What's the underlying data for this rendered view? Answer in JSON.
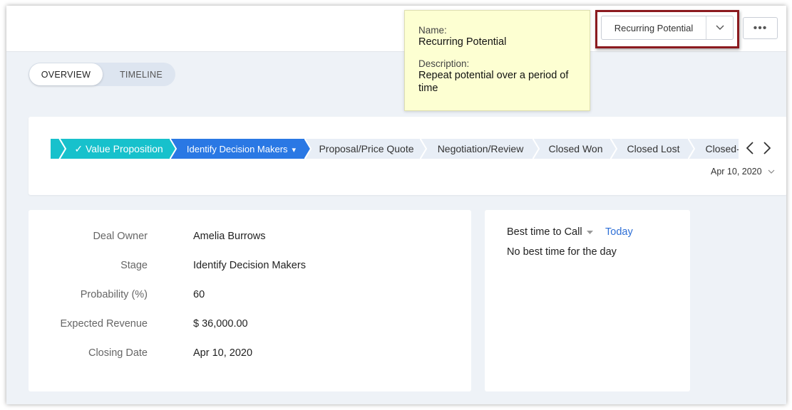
{
  "header": {
    "picker_label": "Recurring Potential",
    "more_label": "•••"
  },
  "tooltip": {
    "name_key": "Name:",
    "name_value": "Recurring Potential",
    "desc_key": "Description:",
    "desc_value": "Repeat potential over a period of time"
  },
  "tabs": [
    {
      "label": "OVERVIEW",
      "active": true
    },
    {
      "label": "TIMELINE",
      "active": false
    }
  ],
  "stages": [
    {
      "label": "",
      "state": "done"
    },
    {
      "label": "Value Proposition",
      "state": "done",
      "check": "✓"
    },
    {
      "label": "Identify Decision Makers",
      "state": "current",
      "caret": "▾"
    },
    {
      "label": "Proposal/Price Quote",
      "state": "pending"
    },
    {
      "label": "Negotiation/Review",
      "state": "pending"
    },
    {
      "label": "Closed Won",
      "state": "pending"
    },
    {
      "label": "Closed Lost",
      "state": "pending"
    },
    {
      "label": "Closed-L",
      "state": "pending"
    }
  ],
  "stage_date": "Apr 10, 2020",
  "colors": {
    "done": "#17c1cc",
    "current": "#2a78e4",
    "pending": "#e8eef6",
    "highlight": "#8b1a1f",
    "link": "#2e6fd6"
  },
  "details": {
    "fields": [
      {
        "label": "Deal Owner",
        "value": "Amelia Burrows"
      },
      {
        "label": "Stage",
        "value": "Identify Decision Makers"
      },
      {
        "label": "Probability (%)",
        "value": "60"
      },
      {
        "label": "Expected Revenue",
        "value": "$ 36,000.00"
      },
      {
        "label": "Closing Date",
        "value": "Apr 10, 2020"
      }
    ]
  },
  "best_time": {
    "label": "Best time to Call",
    "today": "Today",
    "empty": "No best time for the day"
  }
}
